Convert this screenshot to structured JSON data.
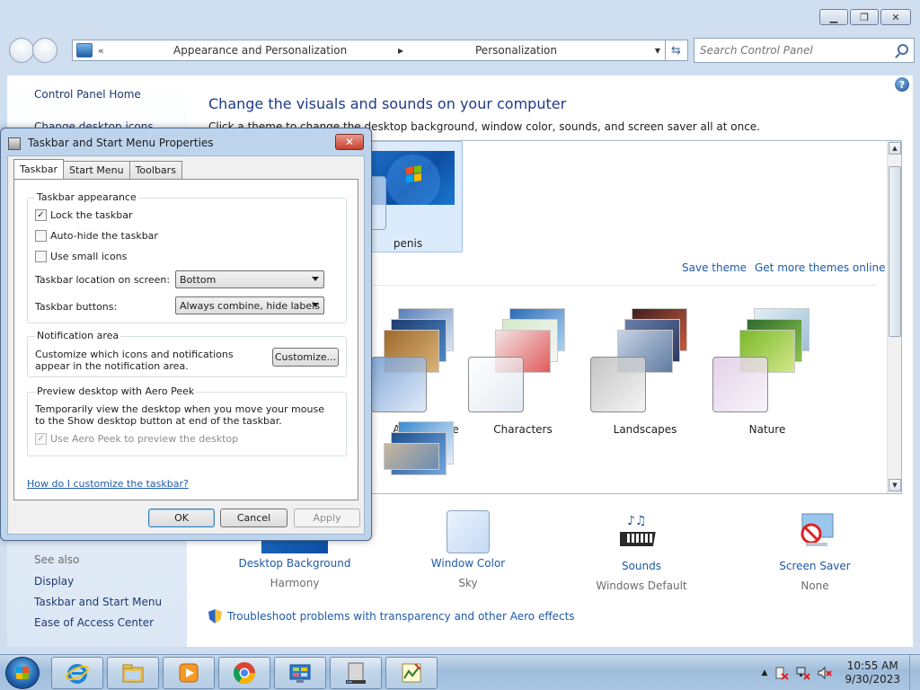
{
  "address": {
    "chevron": "«",
    "segment1": "Appearance and Personalization",
    "segment2": "Personalization"
  },
  "search": {
    "placeholder": "Search Control Panel"
  },
  "left": {
    "home": "Control Panel Home",
    "partial": "Change desktop icons",
    "see_also": "See also",
    "links": [
      "Display",
      "Taskbar and Start Menu",
      "Ease of Access Center"
    ]
  },
  "main": {
    "help": "?",
    "title": "Change the visuals and sounds on your computer",
    "subtitle": "Click a theme to change the desktop background, window color, sounds, and screen saver all at once.",
    "my_theme_name": "penis",
    "save_theme": "Save theme",
    "get_more": "Get more themes online",
    "themes": [
      "Architecture",
      "Characters",
      "Landscapes",
      "Nature"
    ],
    "bottom": [
      {
        "label": "Desktop Background",
        "value": "Harmony"
      },
      {
        "label": "Window Color",
        "value": "Sky"
      },
      {
        "label": "Sounds",
        "value": "Windows Default"
      },
      {
        "label": "Screen Saver",
        "value": "None"
      }
    ],
    "troubleshoot": "Troubleshoot problems with transparency and other Aero effects"
  },
  "dialog": {
    "title": "Taskbar and Start Menu Properties",
    "close": "✕",
    "tabs": [
      "Taskbar",
      "Start Menu",
      "Toolbars"
    ],
    "appearance": {
      "title": "Taskbar appearance",
      "lock": "Lock the taskbar",
      "autohide": "Auto-hide the taskbar",
      "small_icons": "Use small icons",
      "location_label": "Taskbar location on screen:",
      "location_value": "Bottom",
      "buttons_label": "Taskbar buttons:",
      "buttons_value": "Always combine, hide labels"
    },
    "notification": {
      "title": "Notification area",
      "text": "Customize which icons and notifications appear in the notification area.",
      "customize": "Customize..."
    },
    "aero": {
      "title": "Preview desktop with Aero Peek",
      "text": "Temporarily view the desktop when you move your mouse to the Show desktop button at end of the taskbar.",
      "checkbox": "Use Aero Peek to preview the desktop"
    },
    "help_link": "How do I customize the taskbar?",
    "ok": "OK",
    "cancel": "Cancel",
    "apply": "Apply"
  },
  "taskbar": {
    "time": "10:55 AM",
    "date": "9/30/2023",
    "tray_chevron": "▲"
  },
  "colors": {
    "link": "#1e5aa8",
    "title_blue": "#1e3a8a",
    "taskbar": "#a9c5e1"
  }
}
